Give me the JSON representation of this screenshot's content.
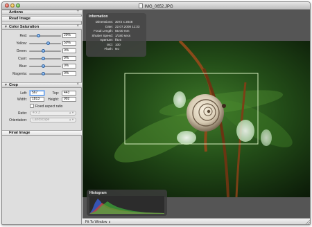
{
  "window": {
    "title": "IMG_0652.JPG"
  },
  "sidebar": {
    "actions_header": "Actions",
    "read_image_label": "Read Image",
    "color_saturation": {
      "header": "Color Saturation",
      "sliders": [
        {
          "label": "Red:",
          "value": "29%",
          "level": 0.29
        },
        {
          "label": "Yellow:",
          "value": "50%",
          "level": 0.6
        },
        {
          "label": "Green:",
          "value": "0%",
          "level": 0.45
        },
        {
          "label": "Cyan:",
          "value": "0%",
          "level": 0.45
        },
        {
          "label": "Blue:",
          "value": "0%",
          "level": 0.45
        },
        {
          "label": "Magenta:",
          "value": "0%",
          "level": 0.45
        }
      ]
    },
    "crop": {
      "header": "Crop",
      "left_label": "Left:",
      "left_value": "567",
      "top_label": "Top:",
      "top_value": "443",
      "width_label": "Width:",
      "width_value": "1813",
      "height_label": "Height:",
      "height_value": "992",
      "fixed_aspect_label": "Fixed aspect ratio",
      "ratio_label": "Ratio:",
      "ratio_value": "4 x 3",
      "orientation_label": "Orientation:",
      "orientation_value": "Landscape"
    },
    "final_image_label": "Final Image"
  },
  "info_panel": {
    "header": "Information",
    "rows": [
      {
        "key": "Dimensions:",
        "value": "3072 x 2048"
      },
      {
        "key": "Date:",
        "value": "22.07.2008 11:33"
      },
      {
        "key": "Focal Length:",
        "value": "55.00 mm"
      },
      {
        "key": "Shutter Speed:",
        "value": "1/180 secs"
      },
      {
        "key": "Aperture:",
        "value": "f/5.6"
      },
      {
        "key": "ISO:",
        "value": "100"
      },
      {
        "key": "Flash:",
        "value": "No"
      }
    ]
  },
  "histogram": {
    "header": "Histogram"
  },
  "bottombar": {
    "zoom_label": "Fit To Window"
  },
  "colors": {
    "accent": "#3f7fcf",
    "crop_frame": "#d8f0c0"
  }
}
